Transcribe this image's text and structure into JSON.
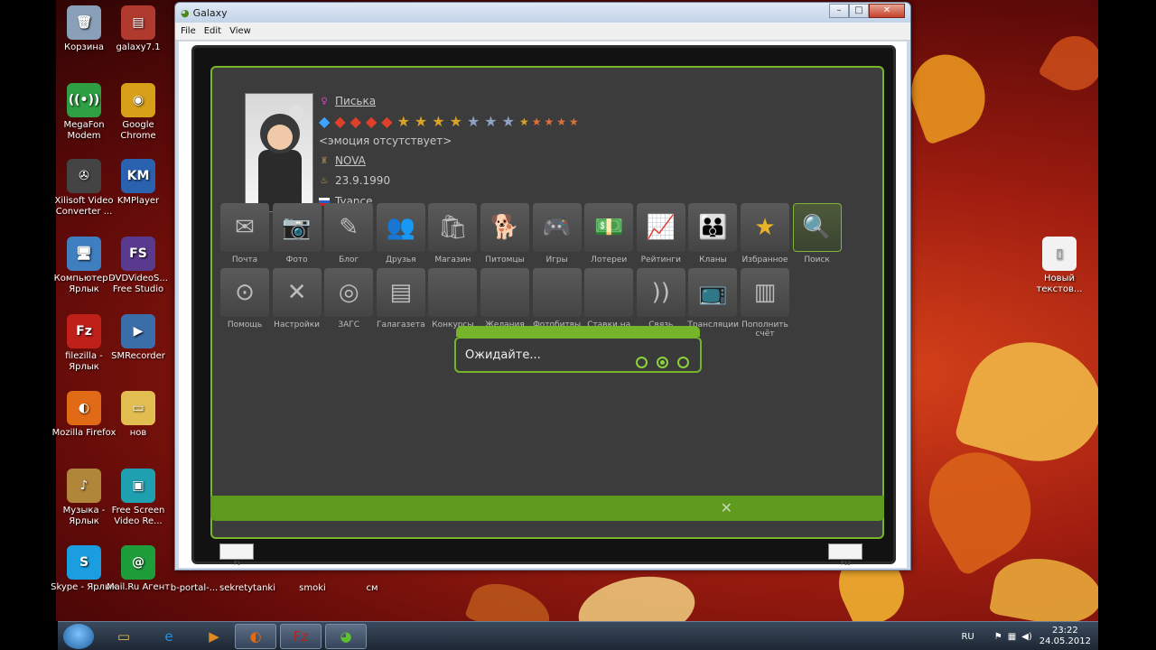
{
  "desktop": {
    "icons": [
      {
        "label": "Корзина",
        "icon": "recycle-bin-icon",
        "color": "#8aa0b8",
        "glyph": "🗑"
      },
      {
        "label": "galaxy7.1",
        "icon": "archive-icon",
        "color": "#b03a2e",
        "glyph": "▤"
      },
      {
        "label": "MegaFon Modem",
        "icon": "megafon-icon",
        "color": "#2ea043",
        "glyph": "((•))"
      },
      {
        "label": "Google Chrome",
        "icon": "chrome-icon",
        "color": "#d8a018",
        "glyph": "◉"
      },
      {
        "label": "Xilisoft Video Converter ...",
        "icon": "film-reel-icon",
        "color": "#444444",
        "glyph": "✇"
      },
      {
        "label": "KMPlayer",
        "icon": "kmplayer-icon",
        "color": "#2a62b0",
        "glyph": "KM"
      },
      {
        "label": "Компьютер - Ярлык",
        "icon": "computer-icon",
        "color": "#3f7fc0",
        "glyph": "🖥"
      },
      {
        "label": "DVDVideoS... Free Studio",
        "icon": "fs-icon",
        "color": "#5a3a8e",
        "glyph": "FS"
      },
      {
        "label": "filezilla - Ярлык",
        "icon": "filezilla-icon",
        "color": "#c0201a",
        "glyph": "Fz"
      },
      {
        "label": "SMRecorder",
        "icon": "recorder-icon",
        "color": "#3a6ea8",
        "glyph": "▶"
      },
      {
        "label": "Mozilla Firefox",
        "icon": "firefox-icon",
        "color": "#e06a16",
        "glyph": "◐"
      },
      {
        "label": "нов",
        "icon": "folder-icon",
        "color": "#e2bd52",
        "glyph": "▭"
      },
      {
        "label": "Музыка - Ярлык",
        "icon": "music-folder-icon",
        "color": "#b0863a",
        "glyph": "♪"
      },
      {
        "label": "Free Screen Video Re...",
        "icon": "screen-recorder-icon",
        "color": "#1fa0b0",
        "glyph": "▣"
      },
      {
        "label": "Skype - Ярлык",
        "icon": "skype-icon",
        "color": "#1a9ee0",
        "glyph": "S"
      },
      {
        "label": "Mail.Ru Агент",
        "icon": "mailru-icon",
        "color": "#1e9e3a",
        "glyph": "@"
      },
      {
        "label": "Новый текстов...",
        "icon": "text-file-icon",
        "color": "#f2f2f2",
        "glyph": "▯"
      }
    ],
    "bottom_labels": [
      "b-portal-...",
      "sekretytanki",
      "smoki",
      "см"
    ]
  },
  "window": {
    "title": "Galaxy",
    "menu": [
      "File",
      "Edit",
      "View"
    ],
    "controls": [
      "–",
      "□",
      "✕"
    ]
  },
  "profile": {
    "nickname": "Писька",
    "gems": [
      {
        "glyph": "◆",
        "color": "#3aa4ff"
      },
      {
        "glyph": "◆",
        "color": "#e0402a"
      },
      {
        "glyph": "◆",
        "color": "#e0402a"
      },
      {
        "glyph": "◆",
        "color": "#e0402a"
      },
      {
        "glyph": "◆",
        "color": "#e0402a"
      },
      {
        "glyph": "★",
        "color": "#d9a22a"
      },
      {
        "glyph": "★",
        "color": "#d9a22a"
      },
      {
        "glyph": "★",
        "color": "#d9a22a"
      },
      {
        "glyph": "★",
        "color": "#d9a22a"
      },
      {
        "glyph": "★",
        "color": "#8fa2c0"
      },
      {
        "glyph": "★",
        "color": "#8fa2c0"
      },
      {
        "glyph": "★",
        "color": "#8fa2c0"
      },
      {
        "glyph": "★",
        "color": "#d9a22a"
      },
      {
        "glyph": "★",
        "color": "#e0703a"
      },
      {
        "glyph": "★",
        "color": "#e0703a"
      },
      {
        "glyph": "★",
        "color": "#e0703a"
      },
      {
        "glyph": "★",
        "color": "#e0703a"
      }
    ],
    "emotion": "<эмоция отсутствует>",
    "clan": "NOVA",
    "birthday": "23.9.1990",
    "location": "Tyance"
  },
  "grid": {
    "row1": [
      {
        "label": "Почта",
        "icon": "mail-icon",
        "glyph": "✉"
      },
      {
        "label": "Фото",
        "icon": "camera-icon",
        "glyph": "📷"
      },
      {
        "label": "Блог",
        "icon": "blog-icon",
        "glyph": "✎"
      },
      {
        "label": "Друзья",
        "icon": "friends-icon",
        "glyph": "👥"
      },
      {
        "label": "Магазин",
        "icon": "shop-icon",
        "glyph": "🛍"
      },
      {
        "label": "Питомцы",
        "icon": "pet-icon",
        "glyph": "🐕"
      },
      {
        "label": "Игры",
        "icon": "gamepad-icon",
        "glyph": "🎮"
      },
      {
        "label": "Лотереи",
        "icon": "lottery-icon",
        "glyph": "💵"
      },
      {
        "label": "Рейтинги",
        "icon": "rating-icon",
        "glyph": "📈"
      },
      {
        "label": "Кланы",
        "icon": "clans-icon",
        "glyph": "👪"
      },
      {
        "label": "Избранное",
        "icon": "star-icon",
        "glyph": "★"
      },
      {
        "label": "Поиск",
        "icon": "search-icon",
        "glyph": "🔍"
      }
    ],
    "row2": [
      {
        "label": "Помощь",
        "icon": "lifebuoy-icon",
        "glyph": "⊙"
      },
      {
        "label": "Настройки",
        "icon": "tools-icon",
        "glyph": "✕"
      },
      {
        "label": "ЗАГС",
        "icon": "rings-icon",
        "glyph": "◎"
      },
      {
        "label": "Галагазета",
        "icon": "newspaper-icon",
        "glyph": "▤"
      },
      {
        "label": "Конкурсы",
        "icon": "contest-icon",
        "glyph": ""
      },
      {
        "label": "Желания",
        "icon": "wish-icon",
        "glyph": ""
      },
      {
        "label": "Фотобитвы",
        "icon": "photobattle-icon",
        "glyph": ""
      },
      {
        "label": "Ставки на спорт",
        "icon": "sport-bet-icon",
        "glyph": ""
      },
      {
        "label": "Связь",
        "icon": "signal-icon",
        "glyph": "))"
      },
      {
        "label": "Трансляции",
        "icon": "tv-icon",
        "glyph": "📺"
      },
      {
        "label": "Пополнить счёт",
        "icon": "wallet-icon",
        "glyph": "▥"
      }
    ]
  },
  "dialog": {
    "text": "Ожидайте..."
  },
  "footer": {
    "left_label": "F1",
    "right_label": "F12"
  },
  "taskbar": {
    "buttons": [
      {
        "icon": "explorer-icon",
        "glyph": "▭",
        "color": "#e2bd52"
      },
      {
        "icon": "ie-icon",
        "glyph": "e",
        "color": "#2a8ee0"
      },
      {
        "icon": "media-player-icon",
        "glyph": "▶",
        "color": "#e08a20"
      },
      {
        "icon": "firefox-icon",
        "glyph": "◐",
        "color": "#e06a16"
      },
      {
        "icon": "filezilla-icon",
        "glyph": "Fz",
        "color": "#c0201a"
      },
      {
        "icon": "galaxy-alien-icon",
        "glyph": "◕",
        "color": "#5ec02a"
      }
    ],
    "lang": "RU",
    "time": "23:22",
    "date": "24.05.2012"
  }
}
